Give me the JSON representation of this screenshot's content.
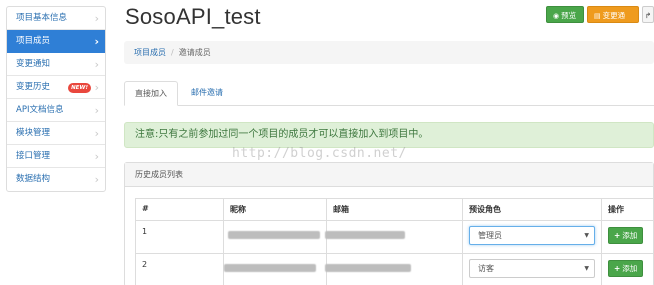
{
  "sidebar": {
    "items": [
      {
        "label": "项目基本信息",
        "active": false
      },
      {
        "label": "项目成员",
        "active": true
      },
      {
        "label": "变更通知",
        "active": false
      },
      {
        "label": "变更历史",
        "active": false,
        "badge": "NEW!"
      },
      {
        "label": "API文档信息",
        "active": false
      },
      {
        "label": "模块管理",
        "active": false
      },
      {
        "label": "接口管理",
        "active": false
      },
      {
        "label": "数据结构",
        "active": false
      }
    ]
  },
  "header": {
    "title": "SosoAPI_test",
    "preview_label": "预览",
    "notify_label": "变更通知"
  },
  "breadcrumb": {
    "parent": "项目成员",
    "separator": "/",
    "current": "邀请成员"
  },
  "tabs": [
    {
      "label": "直接加入",
      "active": true
    },
    {
      "label": "邮件邀请",
      "active": false
    }
  ],
  "alert": {
    "text": "注意:只有之前参加过同一个项目的成员才可以直接加入到项目中。"
  },
  "watermark": "http://blog.csdn.net/",
  "panel": {
    "title": "历史成员列表",
    "columns": [
      "#",
      "昵称",
      "邮箱",
      "预设角色",
      "操作"
    ],
    "rows": [
      {
        "index": "1",
        "role": "管理员",
        "action": "添加"
      },
      {
        "index": "2",
        "role": "访客",
        "action": "添加"
      }
    ]
  },
  "colors": {
    "accent_blue": "#2f7fd6",
    "success_green": "#4aa64a",
    "warning_orange": "#ef9b1e",
    "alert_bg": "#dff0d8",
    "alert_text": "#3c763d",
    "badge_red": "#e9473d"
  }
}
